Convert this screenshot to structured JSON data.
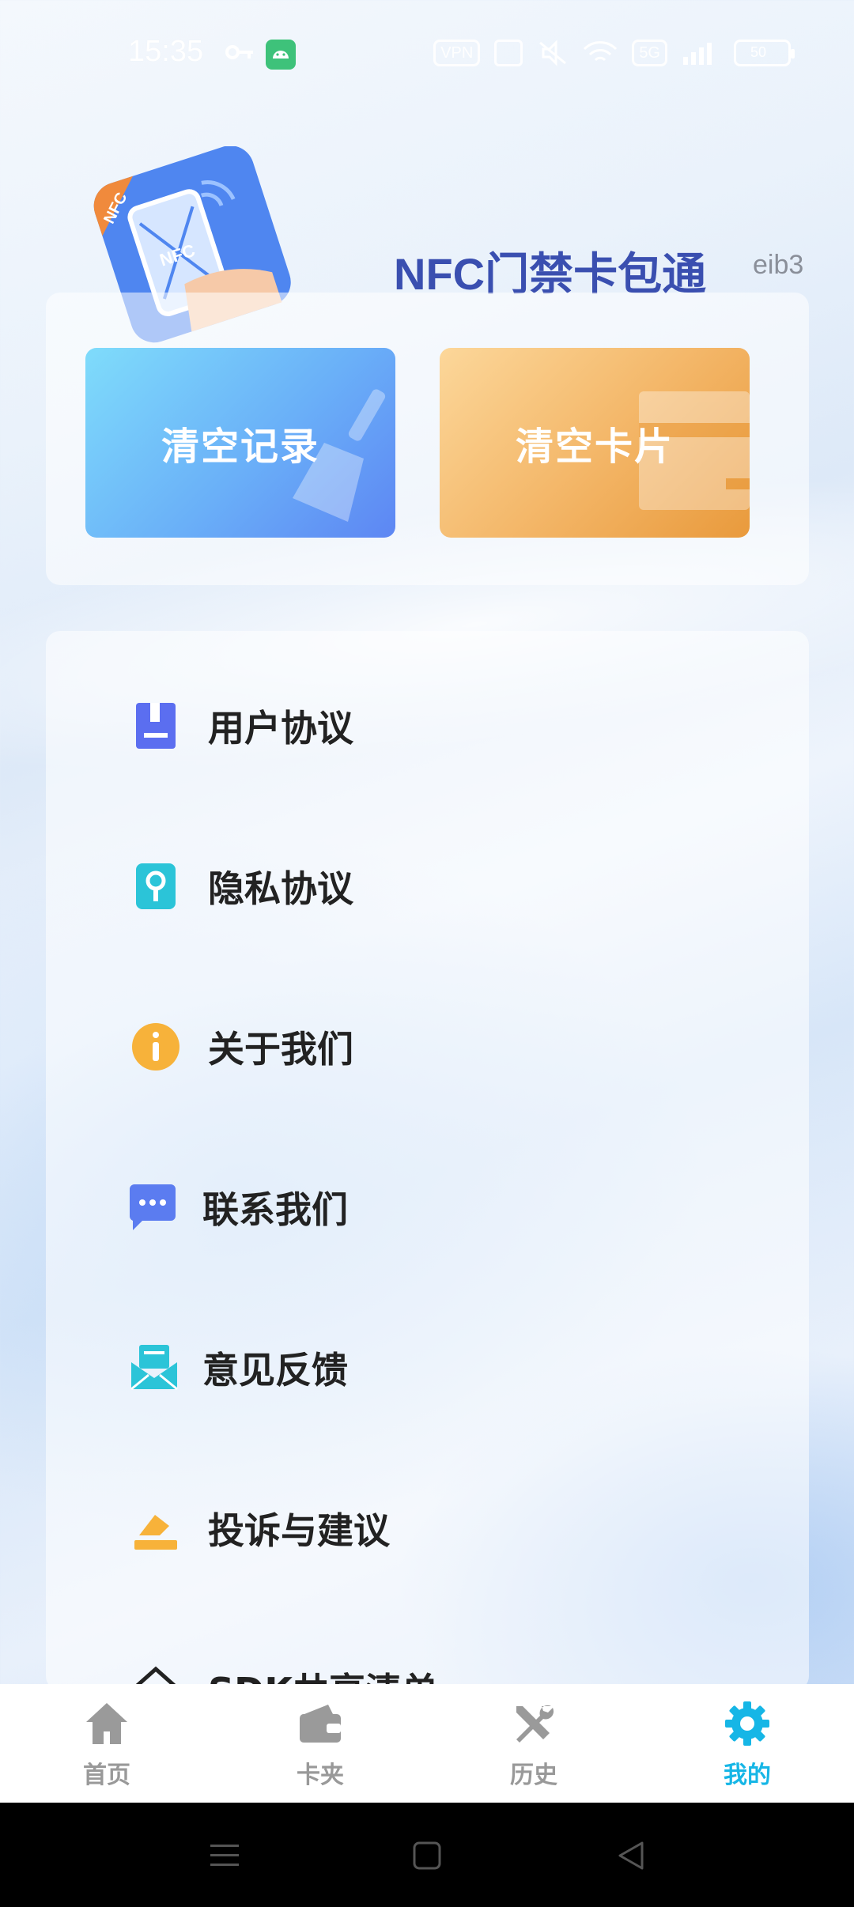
{
  "status_bar": {
    "time": "15:35",
    "vpn_label": "VPN",
    "signal_label": "5G",
    "battery_label": "50"
  },
  "header": {
    "app_name": "NFC门禁卡包通",
    "version": "eib3",
    "logo_badge": "NFC",
    "logo_phone_text": "NFC"
  },
  "actions": {
    "clear_records_label": "清空记录",
    "clear_cards_label": "清空卡片"
  },
  "menu": {
    "items": [
      {
        "label": "用户协议",
        "icon": "document-icon",
        "color": "#5b6ef0"
      },
      {
        "label": "隐私协议",
        "icon": "key-icon",
        "color": "#2bc4d8"
      },
      {
        "label": "关于我们",
        "icon": "info-icon",
        "color": "#f7b23a"
      },
      {
        "label": "联系我们",
        "icon": "chat-icon",
        "color": "#5b7cf0"
      },
      {
        "label": "意见反馈",
        "icon": "mail-icon",
        "color": "#2bc4d8"
      },
      {
        "label": "投诉与建议",
        "icon": "complaint-icon",
        "color": "#f7b23a"
      },
      {
        "label": "SDK共享清单",
        "icon": "home-outline-icon",
        "color": "#222222"
      }
    ]
  },
  "bottom_nav": {
    "items": [
      {
        "label": "首页",
        "icon": "home-icon"
      },
      {
        "label": "卡夹",
        "icon": "wallet-icon"
      },
      {
        "label": "历史",
        "icon": "tools-icon"
      },
      {
        "label": "我的",
        "icon": "gear-icon",
        "active": true
      }
    ],
    "active_color": "#16b6e6",
    "inactive_color": "#999999"
  }
}
